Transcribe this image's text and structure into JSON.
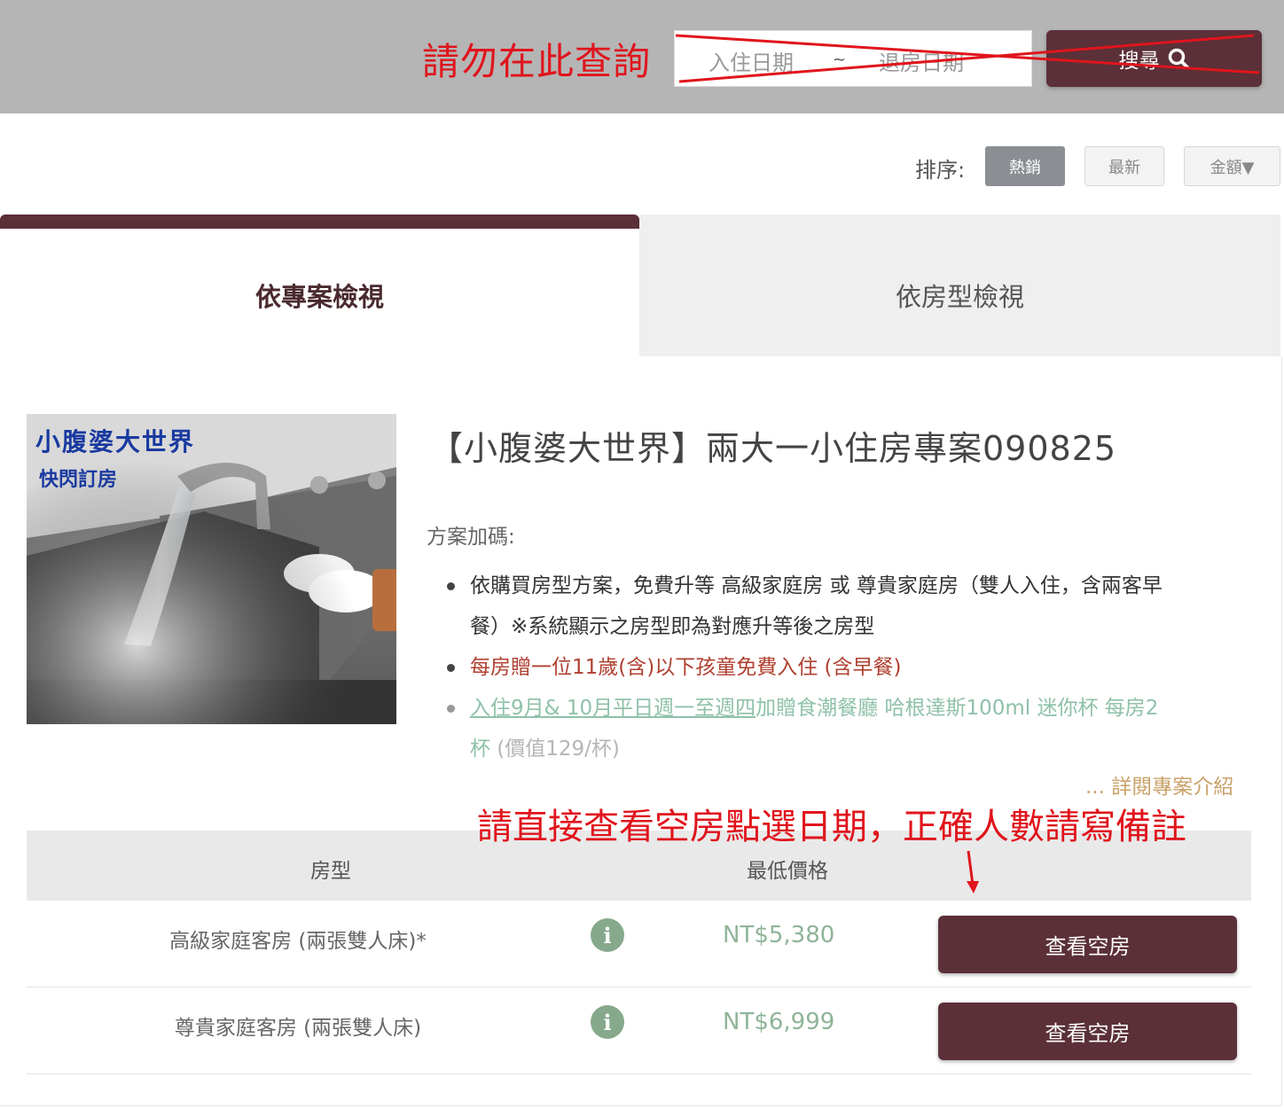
{
  "search": {
    "warning": "請勿在此查詢",
    "checkin_placeholder": "入住日期",
    "separator": "~",
    "checkout_placeholder": "退房日期",
    "button_label": "搜尋"
  },
  "sort": {
    "label": "排序:",
    "options": [
      "熱銷",
      "最新",
      "金額▼"
    ],
    "active_index": 0
  },
  "tabs": [
    {
      "label": "依專案檢視",
      "active": true
    },
    {
      "label": "依房型檢視",
      "active": false
    }
  ],
  "promo_image": {
    "title": "小腹婆大世界",
    "subtitle": "快閃訂房"
  },
  "plan": {
    "title": "【小腹婆大世界】兩大一小住房專案090825",
    "bonus_label": "方案加碼:",
    "bullet1_line1": "依購買房型方案，免費升等 高級家庭房 或 尊貴家庭房（雙人入住，含兩客早",
    "bullet1_line2": "餐）※系統顯示之房型即為對應升等後之房型",
    "bullet2": "每房贈一位11歲(含)以下孩童免費入住 (含早餐)",
    "bullet3_link": "入住9月& 10月平日週一至週四",
    "bullet3_rest_line1": "加贈食潮餐廳 哈根達斯100ml 迷你杯 每房2",
    "bullet3_line2a": "杯",
    "bullet3_line2b": " (價值129/杯)",
    "more_link": "... 詳閱專案介紹"
  },
  "annotation": {
    "note": "請直接查看空房點選日期，正確人數請寫備註"
  },
  "table": {
    "headers": {
      "room_type": "房型",
      "min_price": "最低價格"
    },
    "rows": [
      {
        "name": "高級家庭客房 (兩張雙人床)*",
        "price": "NT$5,380",
        "button": "查看空房"
      },
      {
        "name": "尊貴家庭客房 (兩張雙人床)",
        "price": "NT$6,999",
        "button": "查看空房"
      }
    ]
  },
  "colors": {
    "brand": "#5b3038",
    "warning_red": "#e0141c",
    "price_green": "#8fb498",
    "link_gold": "#c9a36a"
  }
}
